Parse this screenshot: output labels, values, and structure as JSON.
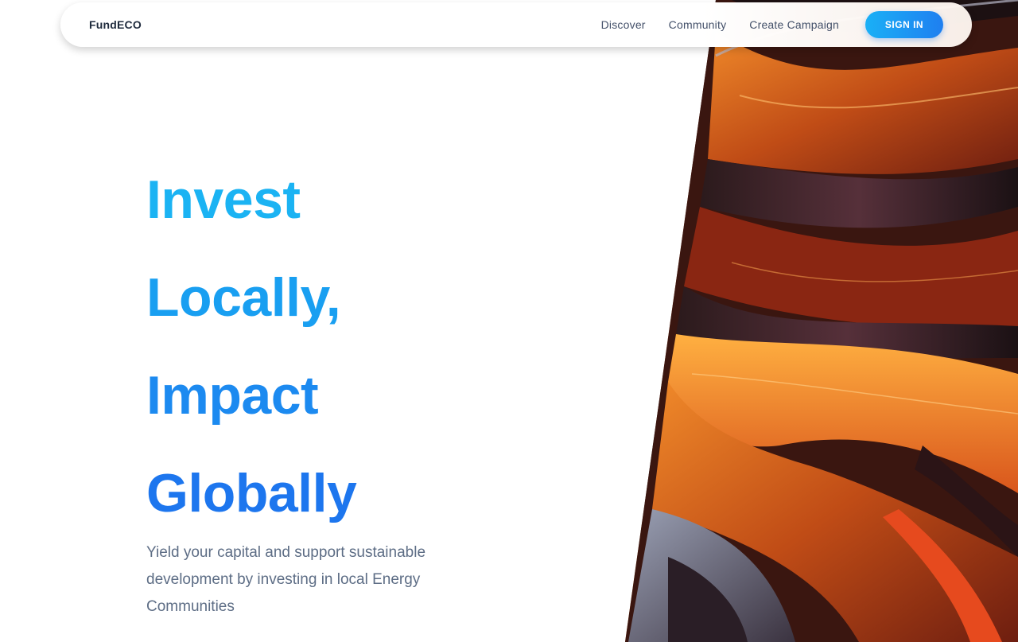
{
  "nav": {
    "brand": "FundECO",
    "links": [
      "Discover",
      "Community",
      "Create Campaign"
    ],
    "signin_label": "SIGN IN"
  },
  "hero": {
    "headline_lines": [
      "Invest",
      "Locally,",
      "Impact",
      "Globally"
    ],
    "subtitle": "Yield your capital and support sustainable development by investing in local Energy Communities"
  },
  "colors": {
    "headline_gradient_start": "#1bb3f3",
    "headline_gradient_end": "#1d76ee",
    "signin_start": "#1ab0f6",
    "signin_end": "#1f7ff0",
    "subtitle": "#5d6d85"
  },
  "icons": {
    "hero_art": "abstract-orange-swirl-art"
  }
}
